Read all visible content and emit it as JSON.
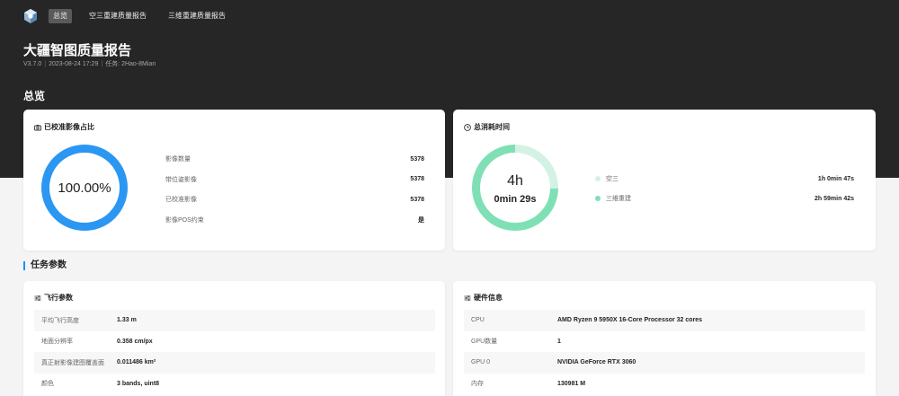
{
  "nav": {
    "tabs": [
      {
        "label": "总览",
        "active": true
      },
      {
        "label": "空三重建质量报告",
        "active": false
      },
      {
        "label": "三维重建质量报告",
        "active": false
      }
    ]
  },
  "header": {
    "title": "大疆智图质量报告",
    "version": "V3.7.0",
    "date": "2023-08-24 17:29",
    "task": "任务: 2Hao-8Mian"
  },
  "overview": {
    "heading": "总览",
    "calibrated": {
      "title": "已校准影像占比",
      "percent_label": "100.00%",
      "percent_value": 1.0,
      "ring_color": "#2b97f3",
      "rows": [
        {
          "key": "影像数量",
          "value": "5378"
        },
        {
          "key": "带位姿影像",
          "value": "5378"
        },
        {
          "key": "已校准影像",
          "value": "5378"
        },
        {
          "key": "影像POS约束",
          "value": "是"
        }
      ]
    },
    "time": {
      "title": "总消耗时间",
      "center_line1": "4h",
      "center_line2": "0min 29s",
      "segments": [
        {
          "key": "空三",
          "value": "1h 0min 47s",
          "seconds": 3647,
          "color": "#d3f2e5"
        },
        {
          "key": "三维重建",
          "value": "2h 59min 42s",
          "seconds": 10782,
          "color": "#7fe0b6"
        }
      ]
    }
  },
  "params": {
    "heading": "任务参数",
    "flight": {
      "title": "飞行参数",
      "rows": [
        {
          "key": "平均飞行高度",
          "value": "1.33 m"
        },
        {
          "key": "地面分辨率",
          "value": "0.358 cm/px"
        },
        {
          "key": "真正射影像建图覆盖面",
          "value": "0.011486 km²"
        },
        {
          "key": "颜色",
          "value": "3 bands, uint8"
        }
      ]
    },
    "hardware": {
      "title": "硬件信息",
      "rows": [
        {
          "key": "CPU",
          "value": "AMD Ryzen 9 5950X 16-Core Processor 32 cores"
        },
        {
          "key": "GPU数量",
          "value": "1"
        },
        {
          "key": "GPU 0",
          "value": "NVIDIA GeForce RTX 3060"
        },
        {
          "key": "内存",
          "value": "130981 M"
        }
      ]
    }
  },
  "colors": {
    "accent": "#1890ff",
    "header_bg": "#262626"
  }
}
